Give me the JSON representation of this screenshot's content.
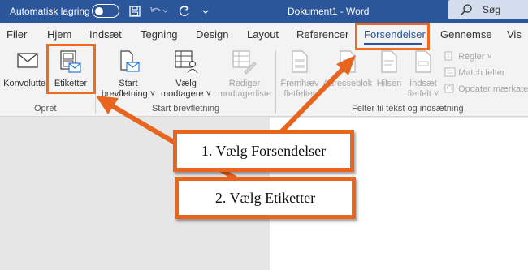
{
  "titlebar": {
    "autosave_label": "Automatisk lagring",
    "document_title": "Dokument1  -  Word",
    "search_label": "Søg",
    "bg_color": "#2b579a"
  },
  "tabs": [
    "Filer",
    "Hjem",
    "Indsæt",
    "Tegning",
    "Design",
    "Layout",
    "Referencer",
    "Forsendelser",
    "Gennemse",
    "Vis"
  ],
  "active_tab": "Forsendelser",
  "ribbon": {
    "opret": {
      "konvolutter": "Konvolutter",
      "etiketter": "Etiketter",
      "group_label": "Opret"
    },
    "start_brevfletning": {
      "start_line1": "Start",
      "start_line2": "brevfletning ˅",
      "vaelg_line1": "Vælg",
      "vaelg_line2": "modtagere ˅",
      "rediger_line1": "Rediger",
      "rediger_line2": "modtagerliste",
      "group_label": "Start brevfletning"
    },
    "felter": {
      "fremhaev_line1": "Fremhæv",
      "fremhaev_line2": "fletfelter",
      "adresseblok": "Adresseblok",
      "hilsen": "Hilsen",
      "indsaet_line1": "Indsæt",
      "indsaet_line2": "fletfelt ˅",
      "regler": "Regler ˅",
      "match_felter": "Match felter",
      "opdater": "Opdater mærkater",
      "group_label": "Felter til tekst og indsætning"
    }
  },
  "callouts": {
    "step1": "1. Vælg Forsendelser",
    "step2": "2. Vælg Etiketter"
  },
  "colors": {
    "accent": "#2b579a",
    "annotation": "#e8651f"
  }
}
